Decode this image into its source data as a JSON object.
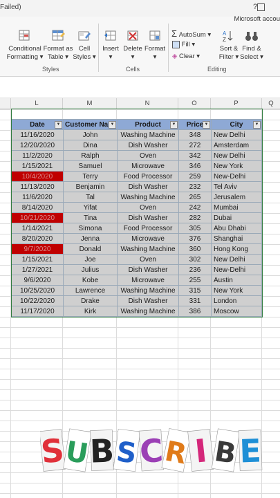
{
  "titlebar": {
    "failed_text": "Failed)",
    "help": "?",
    "account": "Microsoft accou"
  },
  "ribbon": {
    "conditional_formatting": [
      "Conditional",
      "Formatting ▾"
    ],
    "format_as_table": [
      "Format as",
      "Table ▾"
    ],
    "cell_styles": [
      "Cell",
      "Styles ▾"
    ],
    "insert": "Insert",
    "delete": "Delete",
    "format": "Format",
    "autosum": "AutoSum",
    "fill": "Fill",
    "clear": "Clear",
    "sort_filter": [
      "Sort &",
      "Filter ▾"
    ],
    "find_select": [
      "Find &",
      "Select ▾"
    ],
    "groups": {
      "styles": "Styles",
      "cells": "Cells",
      "editing": "Editing"
    }
  },
  "columns": [
    "L",
    "M",
    "N",
    "O",
    "P",
    "Q"
  ],
  "table": {
    "headers": [
      "Date",
      "Customer Nar",
      "Product",
      "Price",
      "City"
    ],
    "rows": [
      {
        "date": "11/16/2020",
        "customer": "John",
        "product": "Washing Machine",
        "price": "348",
        "city": "New Delhi",
        "red": false
      },
      {
        "date": "12/20/2020",
        "customer": "Dina",
        "product": "Dish Washer",
        "price": "272",
        "city": "Amsterdam",
        "red": false
      },
      {
        "date": "11/2/2020",
        "customer": "Ralph",
        "product": "Oven",
        "price": "342",
        "city": "New Delhi",
        "red": false
      },
      {
        "date": "1/15/2021",
        "customer": "Samuel",
        "product": "Microwave",
        "price": "346",
        "city": "New York",
        "red": false
      },
      {
        "date": "10/4/2020",
        "customer": "Terry",
        "product": "Food Processor",
        "price": "259",
        "city": "New-Delhi",
        "red": true
      },
      {
        "date": "11/13/2020",
        "customer": "Benjamin",
        "product": "Dish Washer",
        "price": "232",
        "city": "Tel Aviv",
        "red": false
      },
      {
        "date": "11/6/2020",
        "customer": "Tal",
        "product": "Washing Machine",
        "price": "265",
        "city": "Jerusalem",
        "red": false
      },
      {
        "date": "8/14/2020",
        "customer": "Yifat",
        "product": "Oven",
        "price": "242",
        "city": "Mumbai",
        "red": false
      },
      {
        "date": "10/21/2020",
        "customer": "Tina",
        "product": "Dish Washer",
        "price": "282",
        "city": "Dubai",
        "red": true
      },
      {
        "date": "1/14/2021",
        "customer": "Simona",
        "product": "Food Processor",
        "price": "305",
        "city": "Abu Dhabi",
        "red": false
      },
      {
        "date": "8/20/2020",
        "customer": "Jenna",
        "product": "Microwave",
        "price": "376",
        "city": "Shanghai",
        "red": false
      },
      {
        "date": "9/7/2020",
        "customer": "Donald",
        "product": "Washing Machine",
        "price": "360",
        "city": "Hong Kong",
        "red": true
      },
      {
        "date": "1/15/2021",
        "customer": "Joe",
        "product": "Oven",
        "price": "302",
        "city": "New Delhi",
        "red": false
      },
      {
        "date": "1/27/2021",
        "customer": "Julius",
        "product": "Dish Washer",
        "price": "236",
        "city": "New-Delhi",
        "red": false
      },
      {
        "date": "9/6/2020",
        "customer": "Kobe",
        "product": "Microwave",
        "price": "255",
        "city": "Austin",
        "red": false
      },
      {
        "date": "10/25/2020",
        "customer": "Lawrence",
        "product": "Washing Machine",
        "price": "315",
        "city": "New York",
        "red": false
      },
      {
        "date": "10/22/2020",
        "customer": "Drake",
        "product": "Dish Washer",
        "price": "331",
        "city": "London",
        "red": false
      },
      {
        "date": "11/17/2020",
        "customer": "Kirk",
        "product": "Washing Machine",
        "price": "386",
        "city": "Moscow",
        "red": false
      }
    ]
  },
  "subscribe": {
    "letters": [
      "S",
      "U",
      "B",
      "S",
      "C",
      "R",
      "I",
      "B",
      "E"
    ],
    "colors": [
      "#e0303a",
      "#2a9d5b",
      "#222222",
      "#1f5fc9",
      "#9b3fb5",
      "#e07b1a",
      "#d4277a",
      "#3a3a3a",
      "#1e8fd6"
    ]
  },
  "colors": {
    "header_fill": "#8ea9d5",
    "cell_fill": "#cfcfcf",
    "highlight_red": "#c00000",
    "selection": "#2f7a3d"
  }
}
